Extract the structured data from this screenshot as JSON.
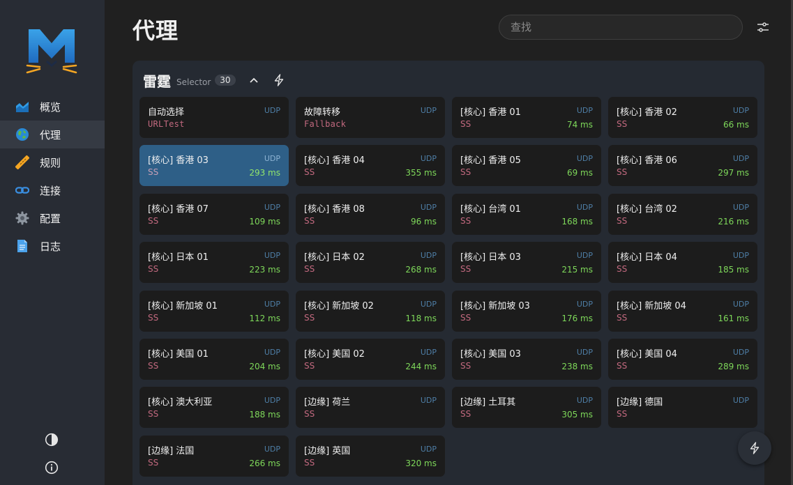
{
  "sidebar": {
    "items": [
      {
        "label": "概览",
        "icon": "chart-icon",
        "active": false
      },
      {
        "label": "代理",
        "icon": "globe-icon",
        "active": true
      },
      {
        "label": "规则",
        "icon": "ruler-icon",
        "active": false
      },
      {
        "label": "连接",
        "icon": "link-icon",
        "active": false
      },
      {
        "label": "配置",
        "icon": "gear-icon",
        "active": false
      },
      {
        "label": "日志",
        "icon": "document-icon",
        "active": false
      }
    ],
    "theme_icon": "contrast-icon",
    "about_icon": "info-icon"
  },
  "header": {
    "title": "代理",
    "search_placeholder": "查找",
    "settings_icon": "sliders-icon"
  },
  "group": {
    "name": "雷霆",
    "type": "Selector",
    "count": "30",
    "proxies": [
      {
        "name": "自动选择",
        "udp": "UDP",
        "type": "URLTest",
        "delay": ""
      },
      {
        "name": "故障转移",
        "udp": "UDP",
        "type": "Fallback",
        "delay": ""
      },
      {
        "name": "[核心] 香港 01",
        "udp": "UDP",
        "type": "SS",
        "delay": "74 ms"
      },
      {
        "name": "[核心] 香港 02",
        "udp": "UDP",
        "type": "SS",
        "delay": "66 ms"
      },
      {
        "name": "[核心] 香港 03",
        "udp": "UDP",
        "type": "SS",
        "delay": "293 ms",
        "selected": true
      },
      {
        "name": "[核心] 香港 04",
        "udp": "UDP",
        "type": "SS",
        "delay": "355 ms"
      },
      {
        "name": "[核心] 香港 05",
        "udp": "UDP",
        "type": "SS",
        "delay": "69 ms"
      },
      {
        "name": "[核心] 香港 06",
        "udp": "UDP",
        "type": "SS",
        "delay": "297 ms"
      },
      {
        "name": "[核心] 香港 07",
        "udp": "UDP",
        "type": "SS",
        "delay": "109 ms"
      },
      {
        "name": "[核心] 香港 08",
        "udp": "UDP",
        "type": "SS",
        "delay": "96 ms"
      },
      {
        "name": "[核心] 台湾 01",
        "udp": "UDP",
        "type": "SS",
        "delay": "168 ms"
      },
      {
        "name": "[核心] 台湾 02",
        "udp": "UDP",
        "type": "SS",
        "delay": "216 ms"
      },
      {
        "name": "[核心] 日本 01",
        "udp": "UDP",
        "type": "SS",
        "delay": "223 ms"
      },
      {
        "name": "[核心] 日本 02",
        "udp": "UDP",
        "type": "SS",
        "delay": "268 ms"
      },
      {
        "name": "[核心] 日本 03",
        "udp": "UDP",
        "type": "SS",
        "delay": "215 ms"
      },
      {
        "name": "[核心] 日本 04",
        "udp": "UDP",
        "type": "SS",
        "delay": "185 ms"
      },
      {
        "name": "[核心] 新加坡 01",
        "udp": "UDP",
        "type": "SS",
        "delay": "112 ms"
      },
      {
        "name": "[核心] 新加坡 02",
        "udp": "UDP",
        "type": "SS",
        "delay": "118 ms"
      },
      {
        "name": "[核心] 新加坡 03",
        "udp": "UDP",
        "type": "SS",
        "delay": "176 ms"
      },
      {
        "name": "[核心] 新加坡 04",
        "udp": "UDP",
        "type": "SS",
        "delay": "161 ms"
      },
      {
        "name": "[核心] 美国 01",
        "udp": "UDP",
        "type": "SS",
        "delay": "204 ms"
      },
      {
        "name": "[核心] 美国 02",
        "udp": "UDP",
        "type": "SS",
        "delay": "244 ms"
      },
      {
        "name": "[核心] 美国 03",
        "udp": "UDP",
        "type": "SS",
        "delay": "238 ms"
      },
      {
        "name": "[核心] 美国 04",
        "udp": "UDP",
        "type": "SS",
        "delay": "289 ms"
      },
      {
        "name": "[核心] 澳大利亚",
        "udp": "UDP",
        "type": "SS",
        "delay": "188 ms"
      },
      {
        "name": "[边缘] 荷兰",
        "udp": "UDP",
        "type": "SS",
        "delay": ""
      },
      {
        "name": "[边缘] 土耳其",
        "udp": "UDP",
        "type": "SS",
        "delay": "305 ms"
      },
      {
        "name": "[边缘] 德国",
        "udp": "UDP",
        "type": "SS",
        "delay": ""
      },
      {
        "name": "[边缘] 法国",
        "udp": "UDP",
        "type": "SS",
        "delay": "266 ms"
      },
      {
        "name": "[边缘] 英国",
        "udp": "UDP",
        "type": "SS",
        "delay": "320 ms"
      }
    ]
  },
  "colors": {
    "accent_selected": "#2e5f87",
    "delay_good": "#7ed85a",
    "proxy_type": "#c2697f",
    "udp_badge": "#4e7ea6"
  }
}
